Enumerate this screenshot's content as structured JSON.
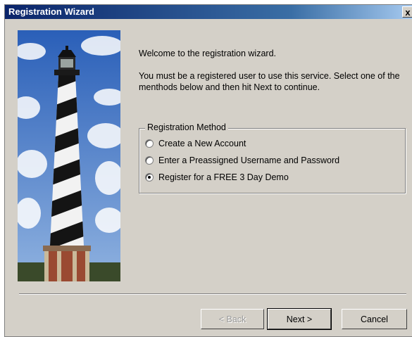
{
  "window": {
    "title": "Registration Wizard",
    "close_label": "x"
  },
  "content": {
    "welcome": "Welcome to the registration wizard.",
    "instructions": "You must be a registered user to use this service.  Select one of the menthods below and then hit Next to continue."
  },
  "registration_method": {
    "legend": "Registration Method",
    "options": [
      {
        "label": "Create a New Account",
        "selected": false
      },
      {
        "label": "Enter a Preassigned Username and Password",
        "selected": false
      },
      {
        "label": "Register for a FREE 3 Day Demo",
        "selected": true
      }
    ]
  },
  "buttons": {
    "back": "< Back",
    "next": "Next >",
    "cancel": "Cancel"
  },
  "colors": {
    "titlebar_start": "#0a246a",
    "titlebar_end": "#a6caf0",
    "dialog_bg": "#d4d0c8"
  }
}
